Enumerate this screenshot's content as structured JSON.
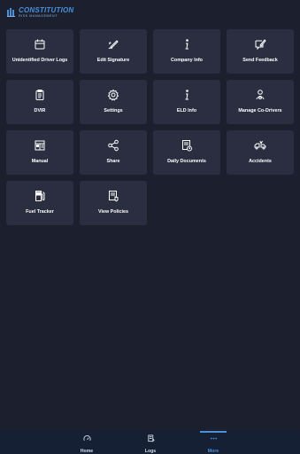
{
  "brand": {
    "main": "CONSTITUTION",
    "sub": "RISK MANAGEMENT",
    "color": "#4a90d9"
  },
  "tiles": [
    {
      "label": "Unidentified Driver Logs",
      "icon": "calendar-icon"
    },
    {
      "label": "Edit Signature",
      "icon": "signature-pen-icon"
    },
    {
      "label": "Company Info",
      "icon": "info-icon"
    },
    {
      "label": "Send Feedback",
      "icon": "feedback-icon"
    },
    {
      "label": "DVIR",
      "icon": "clipboard-icon"
    },
    {
      "label": "Settings",
      "icon": "gear-icon"
    },
    {
      "label": "ELD Info",
      "icon": "info-icon"
    },
    {
      "label": "Manage Co-Drivers",
      "icon": "co-driver-icon"
    },
    {
      "label": "Manual",
      "icon": "manual-icon"
    },
    {
      "label": "Share",
      "icon": "share-icon"
    },
    {
      "label": "Daily Documents",
      "icon": "documents-icon"
    },
    {
      "label": "Accidents",
      "icon": "accident-icon"
    },
    {
      "label": "Fuel Tracker",
      "icon": "fuel-icon"
    },
    {
      "label": "View Policies",
      "icon": "policies-icon"
    }
  ],
  "nav": {
    "home": "Home",
    "logs": "Logs",
    "more": "More",
    "active": "more"
  }
}
